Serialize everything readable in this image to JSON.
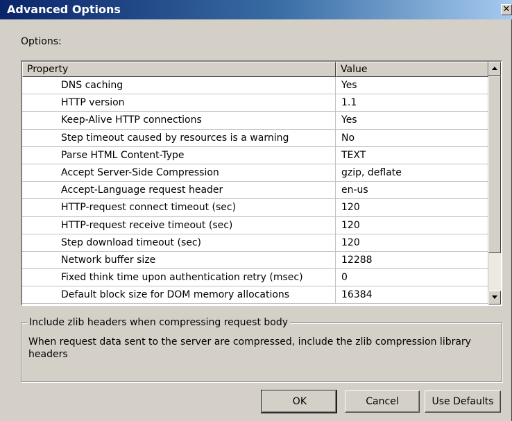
{
  "window": {
    "title": "Advanced Options",
    "close_glyph": "✕"
  },
  "options_label": "Options:",
  "grid": {
    "columns": [
      "Property",
      "Value"
    ],
    "rows": [
      {
        "property": "DNS caching",
        "value": "Yes"
      },
      {
        "property": "HTTP version",
        "value": "1.1"
      },
      {
        "property": "Keep-Alive HTTP connections",
        "value": "Yes"
      },
      {
        "property": "Step timeout caused by resources is a warning",
        "value": "No"
      },
      {
        "property": "Parse HTML Content-Type",
        "value": "TEXT"
      },
      {
        "property": "Accept Server-Side Compression",
        "value": "gzip, deflate"
      },
      {
        "property": "Accept-Language request header",
        "value": "en-us"
      },
      {
        "property": "HTTP-request connect timeout (sec)",
        "value": "120"
      },
      {
        "property": "HTTP-request receive timeout (sec)",
        "value": "120"
      },
      {
        "property": "Step download timeout (sec)",
        "value": "120"
      },
      {
        "property": "Network buffer size",
        "value": "12288"
      },
      {
        "property": "Fixed think time upon authentication retry (msec)",
        "value": "0"
      },
      {
        "property": "Default block size for DOM memory allocations",
        "value": "16384"
      }
    ]
  },
  "description": {
    "title": "Include zlib headers when compressing request body",
    "text": "When request data sent to the server are compressed, include the zlib compression library headers"
  },
  "buttons": {
    "ok": "OK",
    "cancel": "Cancel",
    "defaults": "Use Defaults"
  },
  "colors": {
    "face": "#d4d0c8",
    "title_start": "#0a246a",
    "title_end": "#a6caf0"
  },
  "icons": {
    "close": "close-icon",
    "scroll_up": "scroll-up-arrow-icon",
    "scroll_down": "scroll-down-arrow-icon"
  }
}
